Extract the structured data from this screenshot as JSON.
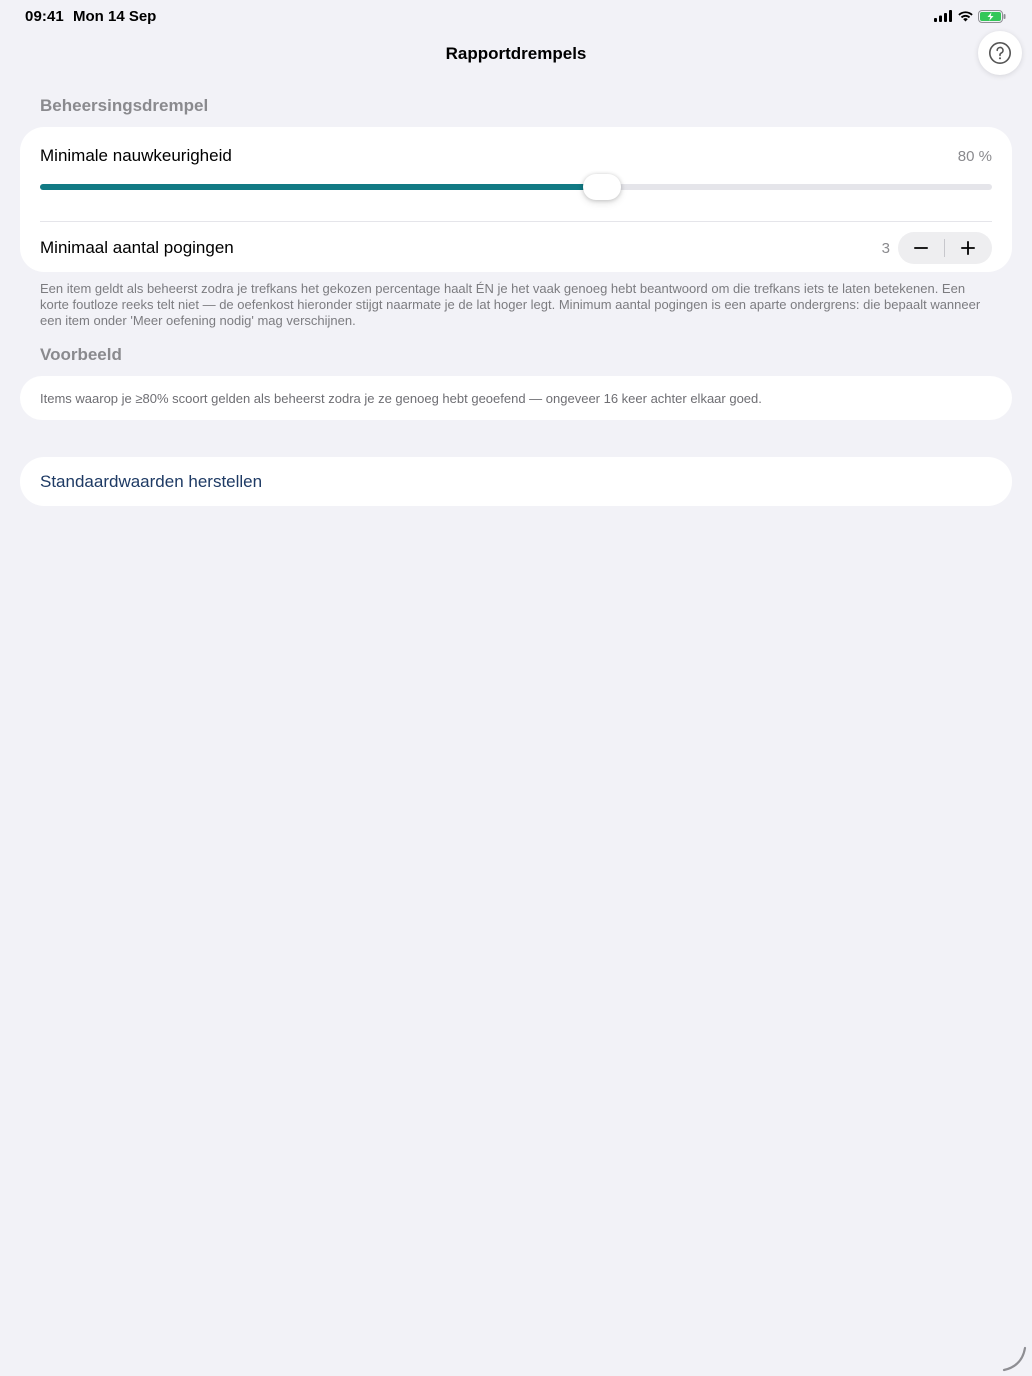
{
  "status_bar": {
    "time": "09:41",
    "date": "Mon 14 Sep",
    "icons": [
      "cellular-signal-icon",
      "wifi-icon",
      "battery-charging-icon"
    ],
    "battery_color": "#34c759"
  },
  "nav": {
    "title": "Rapportdrempels",
    "help_icon": "question-mark-circle-icon"
  },
  "mastery_section": {
    "header": "Beheersingsdrempel",
    "accuracy": {
      "label": "Minimale nauwkeurigheid",
      "value_text": "80 %",
      "slider_fraction": 0.59,
      "accent_color": "#117a84"
    },
    "attempts": {
      "label": "Minimaal aantal pogingen",
      "value": "3",
      "decrement_icon": "minus-icon",
      "increment_icon": "plus-icon"
    },
    "footnote": "Een item geldt als beheerst zodra je trefkans het gekozen percentage haalt ÉN je het vaak genoeg hebt beantwoord om die trefkans iets te laten betekenen. Een korte foutloze reeks telt niet — de oefenkost hieronder stijgt naarmate je de lat hoger legt. Minimum aantal pogingen is een aparte ondergrens: die bepaalt wanneer een item onder 'Meer oefening nodig' mag verschijnen."
  },
  "example_section": {
    "header": "Voorbeeld",
    "text": "Items waarop je ≥80% scoort gelden als beheerst zodra je ze genoeg hebt geoefend — ongeveer 16 keer achter elkaar goed."
  },
  "reset": {
    "label": "Standaardwaarden herstellen",
    "color": "#1e3a64"
  }
}
